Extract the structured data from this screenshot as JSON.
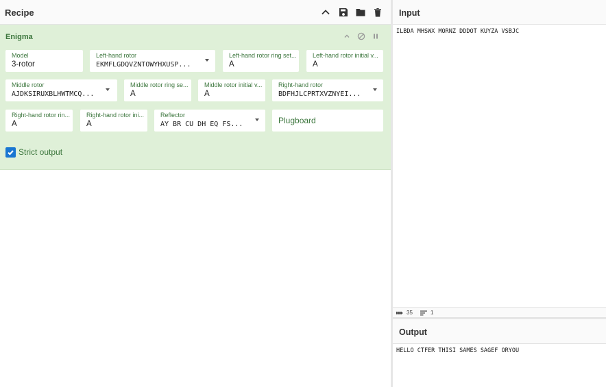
{
  "recipe": {
    "title": "Recipe",
    "actions": {
      "collapse_icon": "chevron-up-icon",
      "save_icon": "save-icon",
      "load_icon": "folder-icon",
      "clear_icon": "trash-icon"
    }
  },
  "operation": {
    "name": "Enigma",
    "icons": [
      "chevron-up-icon",
      "disable-icon",
      "pause-icon"
    ],
    "fields": {
      "model": {
        "label": "Model",
        "value": "3-rotor"
      },
      "left_rotor": {
        "label": "Left-hand rotor",
        "value": "EKMFLGDQVZNTOWYHXUSP..."
      },
      "left_ring": {
        "label": "Left-hand rotor ring set...",
        "value": "A"
      },
      "left_initial": {
        "label": "Left-hand rotor initial v...",
        "value": "A"
      },
      "middle_rotor": {
        "label": "Middle rotor",
        "value": "AJDKSIRUXBLHWTMCQ..."
      },
      "middle_ring": {
        "label": "Middle rotor ring se...",
        "value": "A"
      },
      "middle_initial": {
        "label": "Middle rotor initial v...",
        "value": "A"
      },
      "right_rotor": {
        "label": "Right-hand rotor",
        "value": "BDFHJLCPRTXVZNYEI..."
      },
      "right_ring": {
        "label": "Right-hand rotor rin...",
        "value": "A"
      },
      "right_initial": {
        "label": "Right-hand rotor ini...",
        "value": "A"
      },
      "reflector": {
        "label": "Reflector",
        "value": "AY BR CU DH EQ FS..."
      },
      "plugboard": {
        "placeholder": "Plugboard",
        "value": ""
      }
    },
    "strict_output": {
      "label": "Strict output",
      "checked": true
    }
  },
  "input": {
    "title": "Input",
    "text": "ILBDA MHSWX MORNZ DDDOT KUYZA VSBJC",
    "status": {
      "length": "35",
      "lines": "1"
    }
  },
  "output": {
    "title": "Output",
    "text": "HELLO CTFER THISI SAMES SAGEF ORYOU"
  },
  "colors": {
    "operation_bg": "#dff0d8",
    "operation_text": "#3c763d",
    "checkbox": "#1976d2"
  }
}
